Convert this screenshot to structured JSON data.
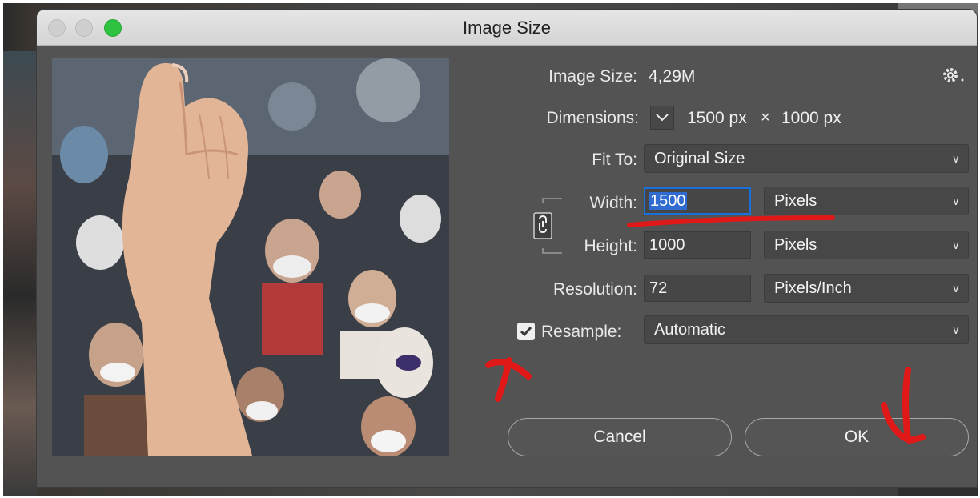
{
  "window": {
    "title": "Image Size"
  },
  "summary": {
    "image_size_label": "Image Size:",
    "image_size_value": "4,29M",
    "dimensions_label": "Dimensions:",
    "width_px": "1500 px",
    "times": "×",
    "height_px": "1000 px"
  },
  "fit_to": {
    "label": "Fit To:",
    "value": "Original Size"
  },
  "width": {
    "label": "Width:",
    "value": "1500",
    "unit": "Pixels"
  },
  "height": {
    "label": "Height:",
    "value": "1000",
    "unit": "Pixels"
  },
  "resolution": {
    "label": "Resolution:",
    "value": "72",
    "unit": "Pixels/Inch"
  },
  "resample": {
    "label": "Resample:",
    "checked": true,
    "value": "Automatic"
  },
  "buttons": {
    "cancel": "Cancel",
    "ok": "OK"
  },
  "icons": {
    "gear": "gear-icon",
    "chain": "chain-link-icon",
    "chevron": "chevron-down-icon",
    "check": "checkmark-icon"
  },
  "colors": {
    "dialog_bg": "#535353",
    "focus_ring": "#1a6fd8",
    "annotation_red": "#e01818",
    "zoom_button": "#2fc140"
  }
}
